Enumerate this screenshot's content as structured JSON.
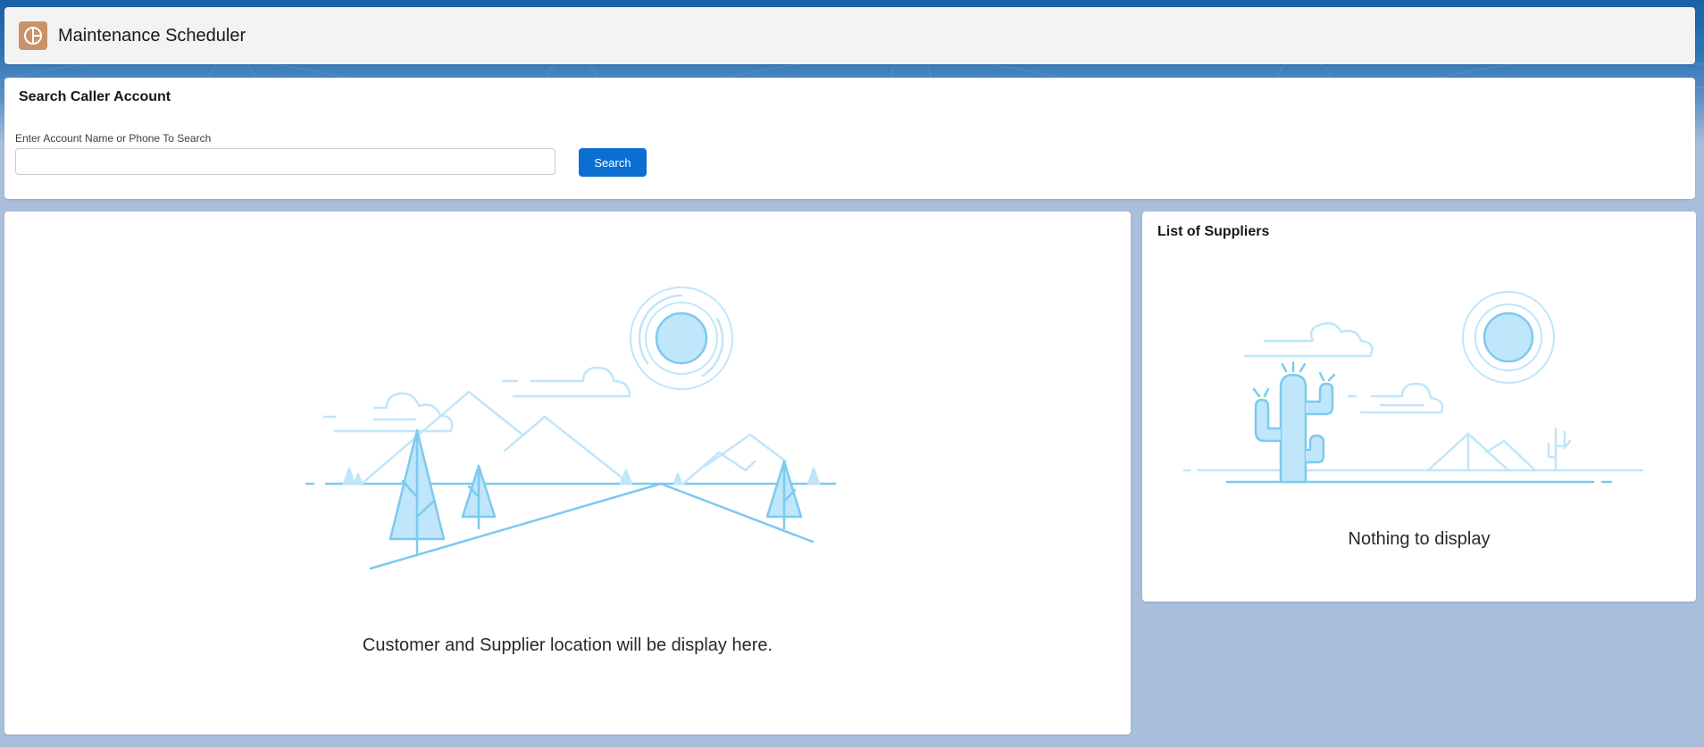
{
  "header": {
    "app_title": "Maintenance Scheduler",
    "app_icon": "scheduler-app-icon",
    "app_icon_color": "#c8936a"
  },
  "search": {
    "title": "Search Caller Account",
    "field_label": "Enter Account Name or Phone To Search",
    "input_value": "",
    "button_label": "Search",
    "button_color": "#0b6fd1"
  },
  "map": {
    "message": "Customer and Supplier location will be display here.",
    "illustration": "mountains-sun-trees-illustration"
  },
  "suppliers": {
    "title": "List of Suppliers",
    "empty_message": "Nothing to display",
    "illustration": "desert-cactus-illustration"
  },
  "colors": {
    "background": "#a8bedb",
    "header_background": "#f3f3f3",
    "illustration_stroke": "#7ccaf0",
    "illustration_fill": "#bfe6fa"
  }
}
